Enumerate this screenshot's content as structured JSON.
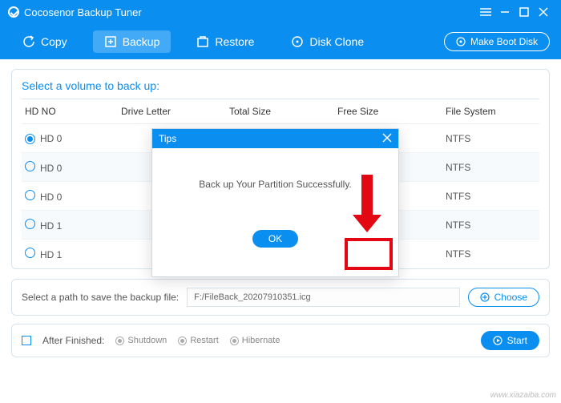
{
  "titlebar": {
    "title": "Cocosenor Backup Tuner"
  },
  "toolbar": {
    "copy": "Copy",
    "backup": "Backup",
    "restore": "Restore",
    "disk_clone": "Disk Clone",
    "make_boot": "Make Boot Disk"
  },
  "volume_panel": {
    "title": "Select a volume to back up:",
    "columns": {
      "hdno": "HD NO",
      "drive": "Drive Letter",
      "total": "Total Size",
      "free": "Free Size",
      "fs": "File System"
    },
    "rows": [
      {
        "selected": true,
        "hd": "HD 0",
        "fs": "NTFS",
        "icon": "win"
      },
      {
        "selected": false,
        "hd": "HD 0",
        "fs": "NTFS",
        "icon": "dark"
      },
      {
        "selected": false,
        "hd": "HD 0",
        "fs": "NTFS",
        "icon": "dark"
      },
      {
        "selected": false,
        "hd": "HD 1",
        "fs": "NTFS",
        "icon": "dark"
      },
      {
        "selected": false,
        "hd": "HD 1",
        "fs": "NTFS",
        "icon": "dark"
      }
    ]
  },
  "path": {
    "label": "Select a path to save the backup file:",
    "value": "F:/FileBack_20207910351.icg",
    "choose": "Choose"
  },
  "footer": {
    "after_label": "After Finished:",
    "opts": {
      "shutdown": "Shutdown",
      "restart": "Restart",
      "hibernate": "Hibernate"
    },
    "start": "Start"
  },
  "modal": {
    "title": "Tips",
    "message": "Back up Your Partition Successfully.",
    "ok": "OK"
  },
  "watermark": "www.xiazaiba.com"
}
